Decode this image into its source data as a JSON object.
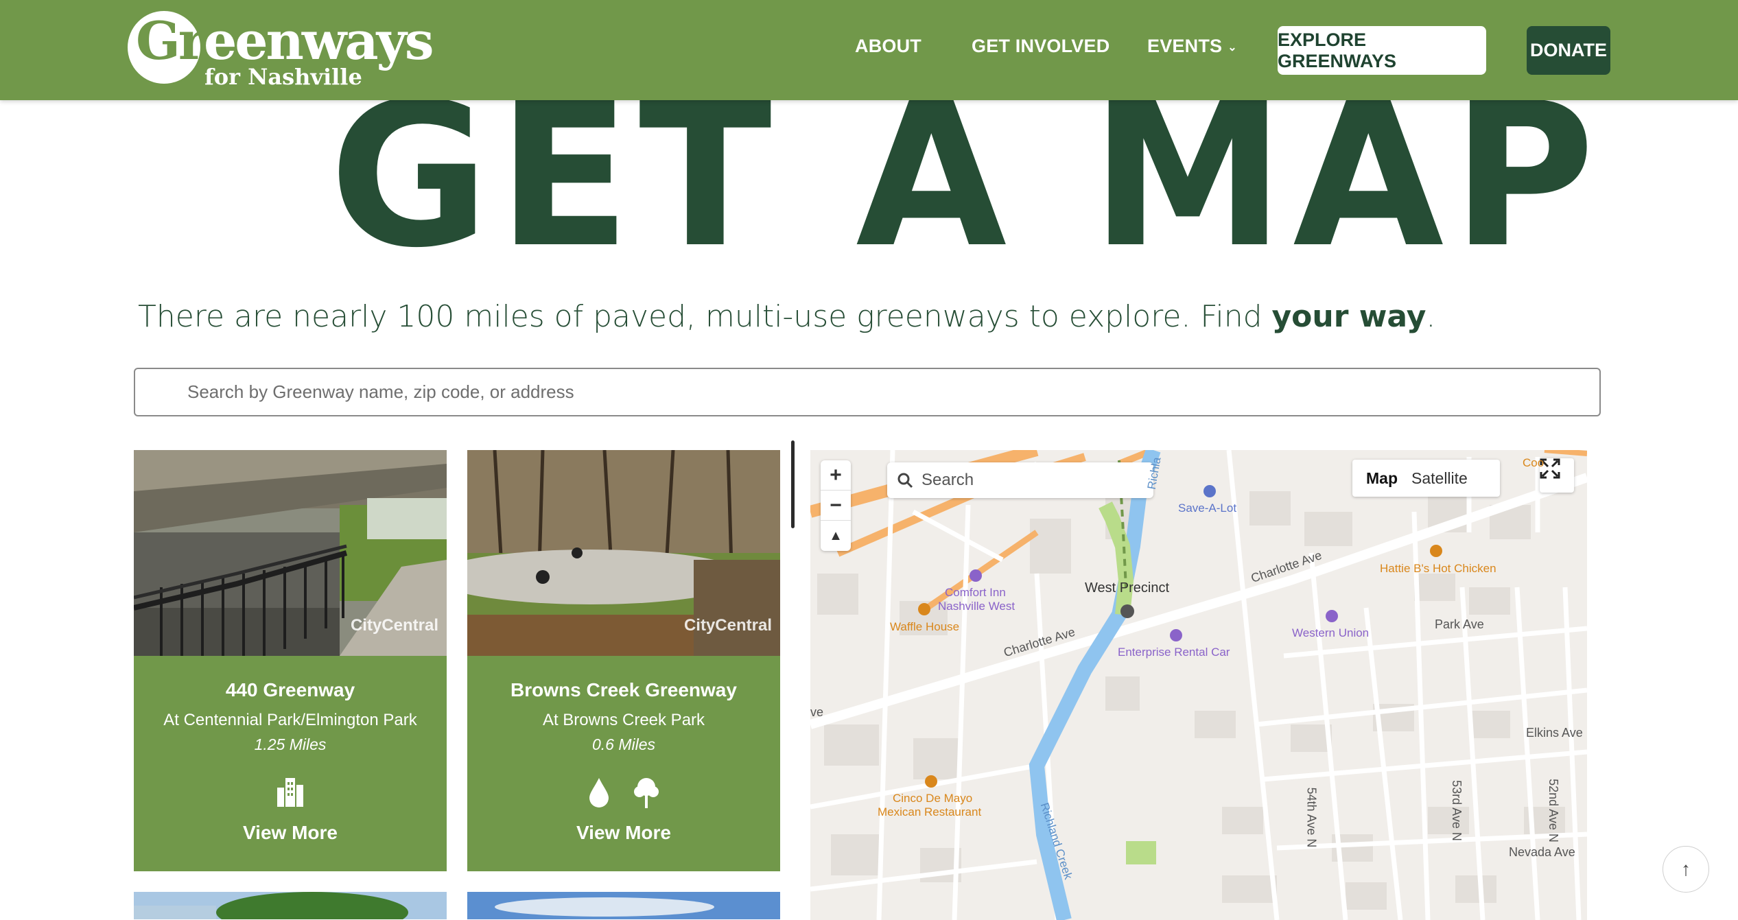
{
  "header": {
    "logo_main": "Greenways",
    "logo_sub": "for Nashville",
    "nav": [
      {
        "label": "ABOUT"
      },
      {
        "label": "GET INVOLVED"
      },
      {
        "label": "EVENTS"
      }
    ],
    "explore_label": "EXPLORE GREENWAYS",
    "donate_label": "DONATE"
  },
  "hero": {
    "title": "GET A MAP",
    "tagline_prefix": "There are nearly 100 miles of paved, multi-use greenways to explore. Find ",
    "tagline_bold": "your way",
    "tagline_suffix": "."
  },
  "search": {
    "placeholder": "Search by Greenway name, zip code, or address"
  },
  "cards": [
    {
      "name": "440 Greenway",
      "location": "At Centennial Park/Elmington Park",
      "miles": "1.25 Miles",
      "watermark": "CityCentral",
      "icons": [
        "city-icon"
      ],
      "cta": "View More"
    },
    {
      "name": "Browns Creek Greenway",
      "location": "At Browns Creek Park",
      "miles": "0.6 Miles",
      "watermark": "CityCentral",
      "icons": [
        "water-drop-icon",
        "tree-icon"
      ],
      "cta": "View More"
    }
  ],
  "map": {
    "search_placeholder": "Search",
    "type_map": "Map",
    "type_satellite": "Satellite",
    "zoom_in": "+",
    "zoom_out": "−",
    "labels": {
      "save_a_lot": "Save-A-Lot",
      "comfort_inn_1": "Comfort Inn",
      "comfort_inn_2": "Nashville West",
      "waffle_house": "Waffle House",
      "west_precinct": "West Precinct",
      "charlotte_ave_1": "Charlotte Ave",
      "charlotte_ave_2": "Charlotte Ave",
      "hattie_b": "Hattie B's Hot Chicken",
      "western_union": "Western Union",
      "park_ave": "Park Ave",
      "enterprise": "Enterprise Rental Car",
      "elkins_ave": "Elkins Ave",
      "cinco_1": "Cinco De Mayo",
      "cinco_2": "Mexican Restaurant",
      "richland_creek": "Richland Creek",
      "richland_top": "Richla",
      "ave_54": "54th Ave N",
      "ave_53": "53rd Ave N",
      "ave_52": "52nd Ave N",
      "nevada_ave": "Nevada Ave",
      "ave_left": "ve",
      "coo_top": "Coo"
    }
  },
  "back_to_top": "↑",
  "colors": {
    "brand_green": "#71984a",
    "dark_green": "#264d35",
    "water": "#8fc4ef"
  }
}
